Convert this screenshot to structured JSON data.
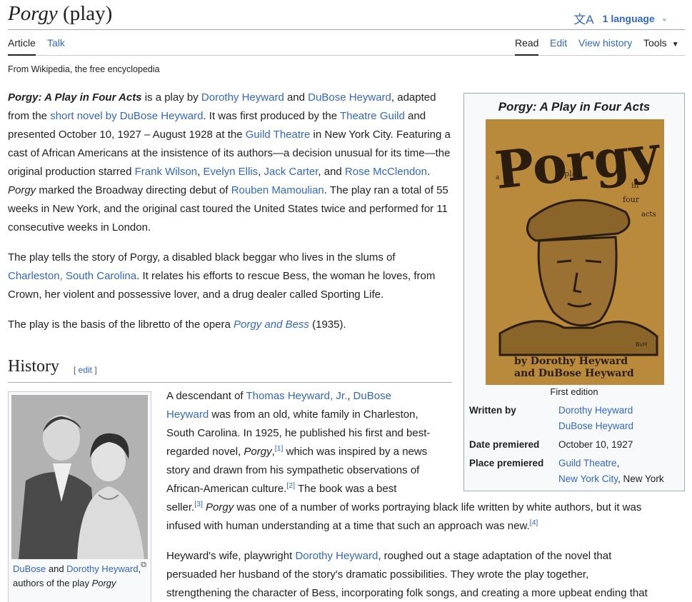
{
  "header": {
    "title_main": "Porgy",
    "title_paren": " (play)",
    "language_button": "1 language"
  },
  "tabs": {
    "left": [
      "Article",
      "Talk"
    ],
    "right": [
      "Read",
      "Edit",
      "View history",
      "Tools"
    ]
  },
  "tagline": "From Wikipedia, the free encyclopedia",
  "intro": {
    "p1": {
      "s1": "Porgy: A Play in Four Acts",
      "s2": " is a play by ",
      "l1": "Dorothy Heyward",
      "s3": " and ",
      "l2": "DuBose Heyward",
      "s4": ", adapted from the ",
      "l3": "short novel by DuBose Heyward",
      "s5": ". It was first produced by the ",
      "l4": "Theatre Guild",
      "s6": " and presented October 10, 1927 – August 1928 at the ",
      "l5": "Guild Theatre",
      "s7": " in New York City. Featuring a cast of African Americans at the insistence of its authors—a decision unusual for its time—the original production starred ",
      "l6": "Frank Wilson",
      "s8": ", ",
      "l7": "Evelyn Ellis",
      "s9": ", ",
      "l8": "Jack Carter",
      "s10": ", and ",
      "l9": "Rose McClendon",
      "s11": ". ",
      "s12": "Porgy",
      "s13": " marked the Broadway directing debut of ",
      "l10": "Rouben Mamoulian",
      "s14": ". The play ran a total of 55 weeks in New York, and the original cast toured the United States twice and performed for 11 consecutive weeks in London."
    },
    "p2": {
      "s1": "The play tells the story of Porgy, a disabled black beggar who lives in the slums of ",
      "l1": "Charleston, South Carolina",
      "s2": ". It relates his efforts to rescue Bess, the woman he loves, from Crown, her violent and possessive lover, and a drug dealer called Sporting Life."
    },
    "p3": {
      "s1": "The play is the basis of the libretto of the opera ",
      "l1": "Porgy and Bess",
      "s2": " (1935)."
    }
  },
  "infobox": {
    "title": "Porgy: A Play in Four Acts",
    "cover": {
      "title_word": "Porgy",
      "side_words": [
        "a",
        "play",
        "in",
        "four",
        "acts"
      ],
      "byline1": "by Dorothy Heyward",
      "byline2": "and DuBose Heyward",
      "monogram": "BvH"
    },
    "caption": "First edition",
    "rows": {
      "written_label": "Written by",
      "written_v1": "Dorothy Heyward",
      "written_v2": "DuBose Heyward",
      "date_label": "Date premiered",
      "date_value": "October 10, 1927",
      "place_label": "Place premiered",
      "place_v1": "Guild Theatre",
      "place_comma": ",",
      "place_v2": "New York City",
      "place_v3": ", New York"
    }
  },
  "history": {
    "title": "History",
    "edit_open": "[ ",
    "edit_label": "edit",
    "edit_close": " ]",
    "thumb": {
      "cap_l1": "DuBose",
      "cap_s1": " and ",
      "cap_l2": "Dorothy Heyward",
      "cap_s2": ", authors of the play ",
      "cap_i": "Porgy"
    },
    "p1": {
      "line1_s": "A descendant of ",
      "line1_l1": "Thomas Heyward, Jr.",
      "line1_c": ", ",
      "line1_l2": "DuBose",
      "line2_l": "Heyward",
      "line2_s": " was from an old, white family in Charleston,",
      "line3": "South Carolina. In 1925, he published his first and best-",
      "line4_s": "regarded novel, ",
      "line4_i": "Porgy",
      "line4_c": ",",
      "ref1": "[1]",
      "line4_e": " which was inspired by a news",
      "line5": "story and drawn from his sympathetic observations of",
      "line6_s": "African-American culture.",
      "ref2": "[2]",
      "line6_e": " The book was a best",
      "line7_s": "seller.",
      "ref3": "[3]",
      "line7_i": " Porgy",
      "line7_e": " was one of a number of works portraying black life written by white authors, but it was",
      "line8": "infused with human understanding at a time that such an approach was new.",
      "ref4": "[4]"
    },
    "p2": {
      "line1_s": "Heyward's wife, playwright ",
      "line1_l": "Dorothy Heyward",
      "line1_e": ", roughed out a stage adaptation of the novel that",
      "line2": "persuaded her husband of the story's dramatic possibilities. They wrote the play together,",
      "line3": "strengthening the character of Bess, incorporating folk songs, and creating a more upbeat ending that"
    }
  }
}
